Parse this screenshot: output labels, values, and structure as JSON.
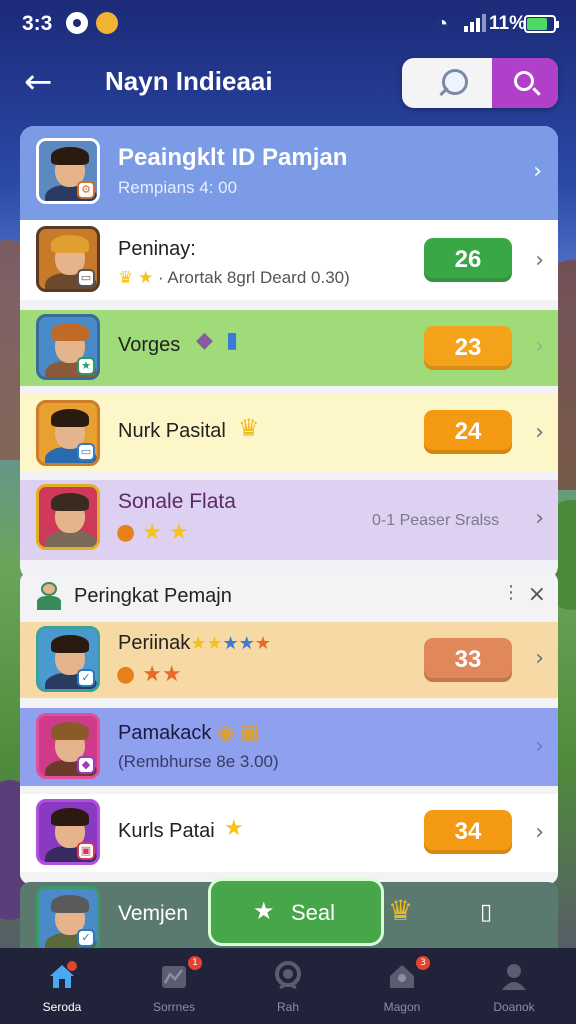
{
  "status_bar": {
    "time": "3:3",
    "battery": "11%",
    "battery_level": 0.75
  },
  "header": {
    "title": "Nayn Indieaai"
  },
  "top_card": {
    "title": "Peaingklt ID Pamjan",
    "subtitle": "Rempians 4: 00"
  },
  "rows": [
    {
      "title": "Peninay:",
      "detail": "Arortak 8grl Deard 0.30)",
      "score": "26",
      "score_color": "#3aa746"
    },
    {
      "title": "Vorges",
      "score": "23",
      "score_color": "#f4a21a"
    },
    {
      "title": "Nurk Pasital",
      "score": "24",
      "score_color": "#f39a12"
    },
    {
      "title": "Sonale Flata",
      "detail": "0-1 Peaser Sralss"
    }
  ],
  "section2": {
    "title": "Peringkat Pemajn",
    "rows": [
      {
        "title": "Periinak",
        "score": "33",
        "score_color": "#e0885a"
      },
      {
        "title": "Pamakack",
        "detail": "(Rembhurse 8e 3.00)"
      },
      {
        "title": "Kurls Patai",
        "score": "34",
        "score_color": "#f39a12"
      }
    ]
  },
  "bottom_strip": {
    "name": "Vemjen",
    "action_label": "Seal"
  },
  "tabs": [
    {
      "label": "Seroda",
      "active": true
    },
    {
      "label": "Sorrnes",
      "badge": "1"
    },
    {
      "label": "Rah"
    },
    {
      "label": "Magon",
      "badge": "3"
    },
    {
      "label": "Doanok"
    }
  ],
  "colors": {
    "accent_purple": "#b03fc9",
    "green": "#3aa746",
    "orange": "#f39a12",
    "tabbar": "#21233a"
  }
}
